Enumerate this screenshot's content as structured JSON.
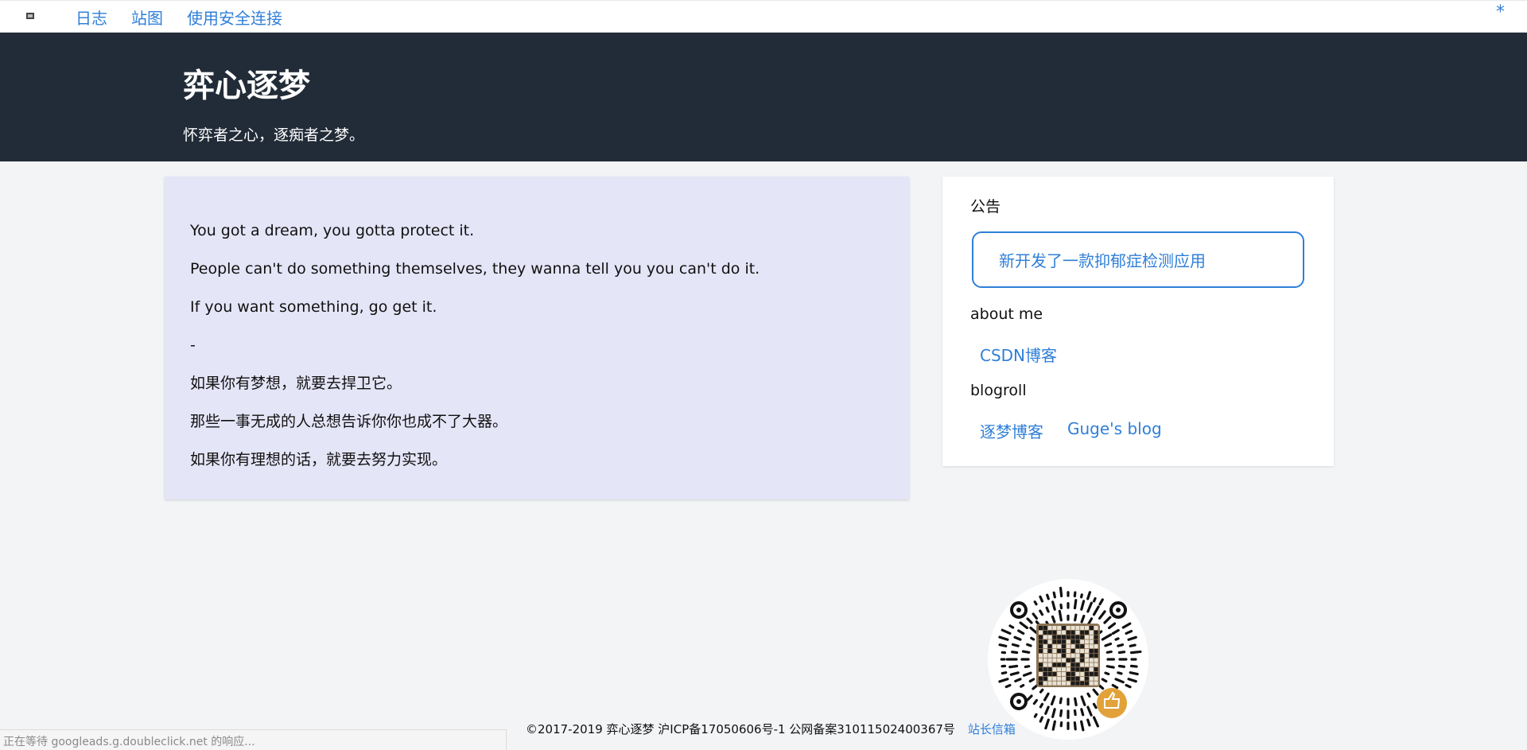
{
  "nav": {
    "logo_icon": "site-logo-icon",
    "links": [
      "日志",
      "站图",
      "使用安全连接"
    ],
    "star": "*"
  },
  "hero": {
    "title": "弈心逐梦",
    "subtitle": "怀弈者之心，逐痴者之梦。"
  },
  "post": {
    "lines": [
      "You got a dream, you gotta protect it.",
      "People can't do something themselves, they wanna tell you you can't do it.",
      "If you want something, go get it.",
      "-",
      "如果你有梦想，就要去捍卫它。",
      "那些一事无成的人总想告诉你你也成不了大器。",
      "如果你有理想的话，就要去努力实现。"
    ]
  },
  "sidebar": {
    "notice_heading": "公告",
    "notice_link": "新开发了一款抑郁症检测应用",
    "about_heading": "about me",
    "about_link": "CSDN博客",
    "blogroll_heading": "blogroll",
    "blogroll_links": [
      "逐梦博客",
      "Guge's blog"
    ]
  },
  "footer": {
    "copyright": "©2017-2019 弈心逐梦 沪ICP备17050606号-1 公网备案31011502400367号",
    "contact_link": "站长信箱"
  },
  "statusbar": {
    "text": "正在等待 googleads.g.doubleclick.net 的响应..."
  },
  "colors": {
    "hero_bg": "#222c38",
    "link": "#2f7fd8",
    "post_bg": "#e5e5f8",
    "page_bg": "#f3f4f6"
  }
}
